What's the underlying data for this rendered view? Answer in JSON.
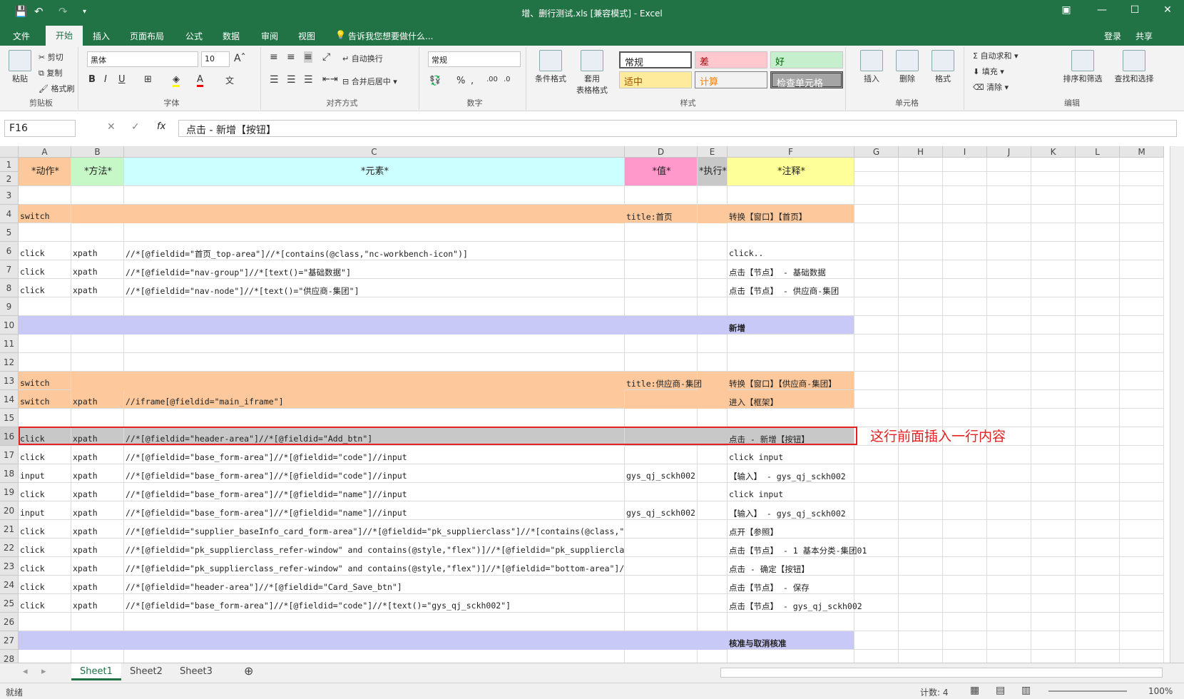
{
  "window": {
    "title": "增、删行测试.xls [兼容模式] - Excel",
    "share": "共享",
    "login": "登录"
  },
  "menu": [
    "文件",
    "开始",
    "插入",
    "页面布局",
    "公式",
    "数据",
    "审阅",
    "视图"
  ],
  "tellme": "告诉我您想要做什么...",
  "ribbon": {
    "clipboard": {
      "paste": "粘贴",
      "cut": "剪切",
      "copy": "复制",
      "format_painter": "格式刷",
      "label": "剪贴板"
    },
    "font": {
      "name": "黑体",
      "size": "10",
      "label": "字体"
    },
    "alignment": {
      "wrap": "自动换行",
      "merge": "合并后居中",
      "label": "对齐方式"
    },
    "number": {
      "format": "常规",
      "label": "数字"
    },
    "styles": {
      "cond": "条件格式",
      "table": "套用\n表格格式",
      "normal": "常规",
      "bad": "差",
      "good": "好",
      "neutral": "适中",
      "calc": "计算",
      "check": "检查单元格",
      "label": "样式"
    },
    "cells": {
      "insert": "插入",
      "delete": "删除",
      "format": "格式",
      "label": "单元格"
    },
    "editing": {
      "autosum": "自动求和",
      "fill": "填充",
      "clear": "清除",
      "sort": "排序和筛选",
      "find": "查找和选择",
      "label": "编辑"
    }
  },
  "formula": {
    "namebox": "F16",
    "fx": "fx",
    "content": "点击 - 新增【按钮】"
  },
  "columns": [
    "A",
    "B",
    "C",
    "D",
    "E",
    "F",
    "G",
    "H",
    "I",
    "J",
    "K",
    "L",
    "M"
  ],
  "rows": [
    {
      "n": "1"
    },
    {
      "n": "2"
    },
    {
      "n": "3"
    },
    {
      "n": "4"
    },
    {
      "n": "5"
    },
    {
      "n": "6"
    },
    {
      "n": "7"
    },
    {
      "n": "8"
    },
    {
      "n": "9"
    },
    {
      "n": "10"
    },
    {
      "n": "11"
    },
    {
      "n": "12"
    },
    {
      "n": "13"
    },
    {
      "n": "14"
    },
    {
      "n": "15"
    },
    {
      "n": "16"
    },
    {
      "n": "17"
    },
    {
      "n": "18"
    },
    {
      "n": "19"
    },
    {
      "n": "20"
    },
    {
      "n": "21"
    },
    {
      "n": "22"
    },
    {
      "n": "23"
    },
    {
      "n": "24"
    },
    {
      "n": "25"
    },
    {
      "n": "26"
    },
    {
      "n": "27"
    },
    {
      "n": "28"
    }
  ],
  "header_cells": {
    "A": "*动作*",
    "B": "*方法*",
    "C": "*元素*",
    "D": "*值*",
    "E": "*执行*",
    "F": "*注释*"
  },
  "data": [
    {
      "r": 4,
      "A": "switch",
      "B": "",
      "C": "",
      "D": "title:首页",
      "F": "转换【窗口】【首页】",
      "fill": "#fdc99c"
    },
    {
      "r": 6,
      "A": "click",
      "B": "xpath",
      "C": "//*[@fieldid=\"首页_top-area\"]//*[contains(@class,\"nc-workbench-icon\")]",
      "D": "",
      "F": "click..",
      "fill": ""
    },
    {
      "r": 7,
      "A": "click",
      "B": "xpath",
      "C": "//*[@fieldid=\"nav-group\"]//*[text()=\"基础数据\"]",
      "D": "",
      "F": "点击【节点】 - 基础数据",
      "fill": ""
    },
    {
      "r": 8,
      "A": "click",
      "B": "xpath",
      "C": "//*[@fieldid=\"nav-node\"]//*[text()=\"供应商-集团\"]",
      "D": "",
      "F": "点击【节点】 - 供应商-集团",
      "fill": ""
    },
    {
      "r": 10,
      "A": "",
      "B": "",
      "C": "",
      "D": "",
      "F": "新增",
      "fill": "#c8c9f7"
    },
    {
      "r": 13,
      "A": "switch",
      "B": "",
      "C": "",
      "D": "title:供应商-集团",
      "F": "转换【窗口】【供应商-集团】",
      "fill": "#fdc99c"
    },
    {
      "r": 14,
      "A": "switch",
      "B": "xpath",
      "C": "//iframe[@fieldid=\"main_iframe\"]",
      "D": "",
      "F": "进入【框架】",
      "fill": "#fdc99c"
    },
    {
      "r": 16,
      "A": "click",
      "B": "xpath",
      "C": "//*[@fieldid=\"header-area\"]//*[@fieldid=\"Add_btn\"]",
      "D": "",
      "F": "点击 - 新增【按钮】",
      "fill": "#c8c8c8"
    },
    {
      "r": 17,
      "A": "click",
      "B": "xpath",
      "C": "//*[@fieldid=\"base_form-area\"]//*[@fieldid=\"code\"]//input",
      "D": "",
      "F": "click input",
      "fill": ""
    },
    {
      "r": 18,
      "A": "input",
      "B": "xpath",
      "C": "//*[@fieldid=\"base_form-area\"]//*[@fieldid=\"code\"]//input",
      "D": "gys_qj_sckh002",
      "F": "【输入】 - gys_qj_sckh002",
      "fill": ""
    },
    {
      "r": 19,
      "A": "click",
      "B": "xpath",
      "C": "//*[@fieldid=\"base_form-area\"]//*[@fieldid=\"name\"]//input",
      "D": "",
      "F": "click input",
      "fill": ""
    },
    {
      "r": 20,
      "A": "input",
      "B": "xpath",
      "C": "//*[@fieldid=\"base_form-area\"]//*[@fieldid=\"name\"]//input",
      "D": "gys_qj_sckh002",
      "F": "【输入】 - gys_qj_sckh002",
      "fill": ""
    },
    {
      "r": 21,
      "A": "click",
      "B": "xpath",
      "C": "//*[@fieldid=\"supplier_baseInfo_card_form-area\"]//*[@fieldid=\"pk_supplierclass\"]//*[contains(@class,\"icon-refer\")]",
      "D": "",
      "F": "点开【参照】",
      "fill": ""
    },
    {
      "r": 22,
      "A": "click",
      "B": "xpath",
      "C": "//*[@fieldid=\"pk_supplierclass_refer-window\" and contains(@style,\"flex\")]//*[@fieldid=\"pk_supplierclass_tree\"]//*[@fieldi",
      "D": "",
      "F": "点击【节点】 - 1 基本分类-集团01",
      "fill": ""
    },
    {
      "r": 23,
      "A": "click",
      "B": "xpath",
      "C": "//*[@fieldid=\"pk_supplierclass_refer-window\" and contains(@style,\"flex\")]//*[@fieldid=\"bottom-area\"]//*[@fieldid=\"sure_bt",
      "D": "",
      "F": "点击 - 确定【按钮】",
      "fill": ""
    },
    {
      "r": 24,
      "A": "click",
      "B": "xpath",
      "C": "//*[@fieldid=\"header-area\"]//*[@fieldid=\"Card_Save_btn\"]",
      "D": "",
      "F": "点击【节点】 - 保存",
      "fill": ""
    },
    {
      "r": 25,
      "A": "click",
      "B": "xpath",
      "C": "//*[@fieldid=\"base_form-area\"]//*[@fieldid=\"code\"]//*[text()=\"gys_qj_sckh002\"]",
      "D": "",
      "F": "点击【节点】 - gys_qj_sckh002",
      "fill": ""
    },
    {
      "r": 27,
      "A": "",
      "B": "",
      "C": "",
      "D": "",
      "F": "核准与取消核准",
      "fill": "#c8c9f7"
    }
  ],
  "annotation": "这行前面插入一行内容",
  "sheets": [
    "Sheet1",
    "Sheet2",
    "Sheet3"
  ],
  "status": {
    "ready": "就绪",
    "count": "计数: 4",
    "zoom": "100%"
  }
}
